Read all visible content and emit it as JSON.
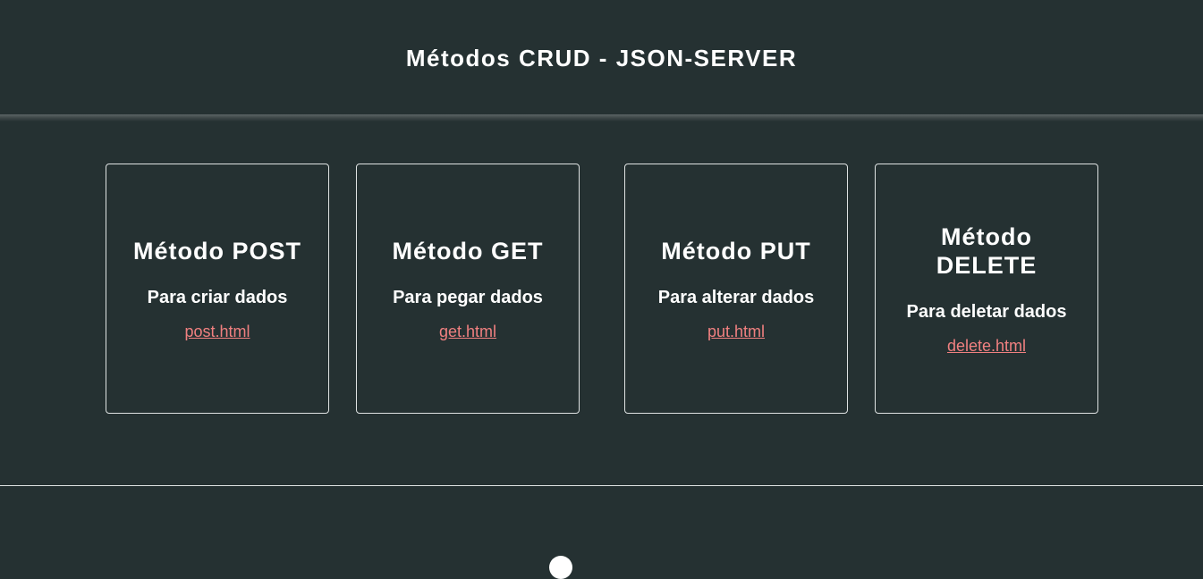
{
  "header": {
    "title": "Métodos CRUD - JSON-SERVER"
  },
  "cards": [
    {
      "title": "Método POST",
      "description": "Para criar dados",
      "link": "post.html"
    },
    {
      "title": "Método GET",
      "description": "Para pegar dados",
      "link": "get.html"
    },
    {
      "title": "Método PUT",
      "description": "Para alterar dados",
      "link": "put.html"
    },
    {
      "title": "Método DELETE",
      "description": "Para deletar dados",
      "link": "delete.html"
    }
  ],
  "colors": {
    "background": "#253132",
    "text": "#ffffff",
    "link": "#f08080",
    "border": "#dfe3e3"
  },
  "footer": {
    "icon": "circle-icon"
  }
}
